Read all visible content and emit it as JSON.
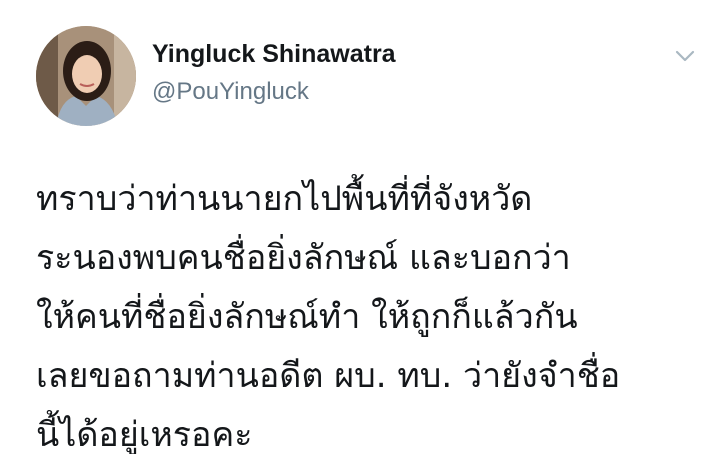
{
  "tweet": {
    "author": {
      "display_name": "Yingluck Shinawatra",
      "handle": "@PouYingluck"
    },
    "icons": {
      "avatar": "profile-photo",
      "menu": "chevron-down-icon"
    },
    "body_lines": [
      "ทราบว่าท่านนายกไปพื้นที่ที่จังหวัด",
      "ระนองพบคนชื่อยิ่งลักษณ์ และบอกว่า",
      " ให้คนที่ชื่อยิ่งลักษณ์ทำ ให้ถูกก็แล้วกัน",
      "เลยขอถามท่านอดีต ผบ. ทบ. ว่ายังจำชื่อ",
      "นี้ได้อยู่เหรอคะ"
    ]
  },
  "colors": {
    "name_text": "#14171a",
    "handle_text": "#657786",
    "caret": "#aab8c2",
    "background": "#ffffff"
  }
}
